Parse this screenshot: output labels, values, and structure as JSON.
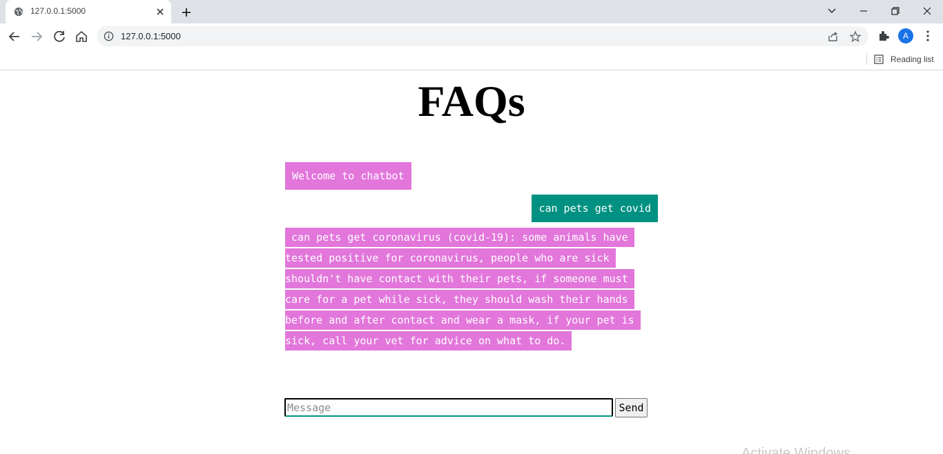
{
  "browser": {
    "tab_title": "127.0.0.1:5000",
    "url": "127.0.0.1:5000",
    "avatar_letter": "A",
    "reading_list_label": "Reading list"
  },
  "page": {
    "title": "FAQs"
  },
  "chat": {
    "welcome": "Welcome to chatbot",
    "user_message": "can pets get covid",
    "bot_reply": " can pets get coronavirus (covid-19): some animals have tested positive for coronavirus, people who are sick shouldn't have contact with their pets, if someone must care for a pet while sick, they should wash their hands before and after contact and wear a mask, if your pet is sick, call your vet for advice on what to do. "
  },
  "composer": {
    "placeholder": "Message",
    "value": "",
    "send_label": "Send"
  },
  "watermark": "Activate Windows",
  "colors": {
    "bot_bubble": "#e276db",
    "user_bubble": "#009182",
    "chrome_tabstrip": "#dee1e6"
  },
  "icons": [
    "globe-icon",
    "close-icon",
    "plus-icon",
    "back-icon",
    "forward-icon",
    "reload-icon",
    "home-icon",
    "info-icon",
    "share-icon",
    "star-icon",
    "puzzle-icon",
    "kebab-menu-icon",
    "reading-list-icon"
  ]
}
